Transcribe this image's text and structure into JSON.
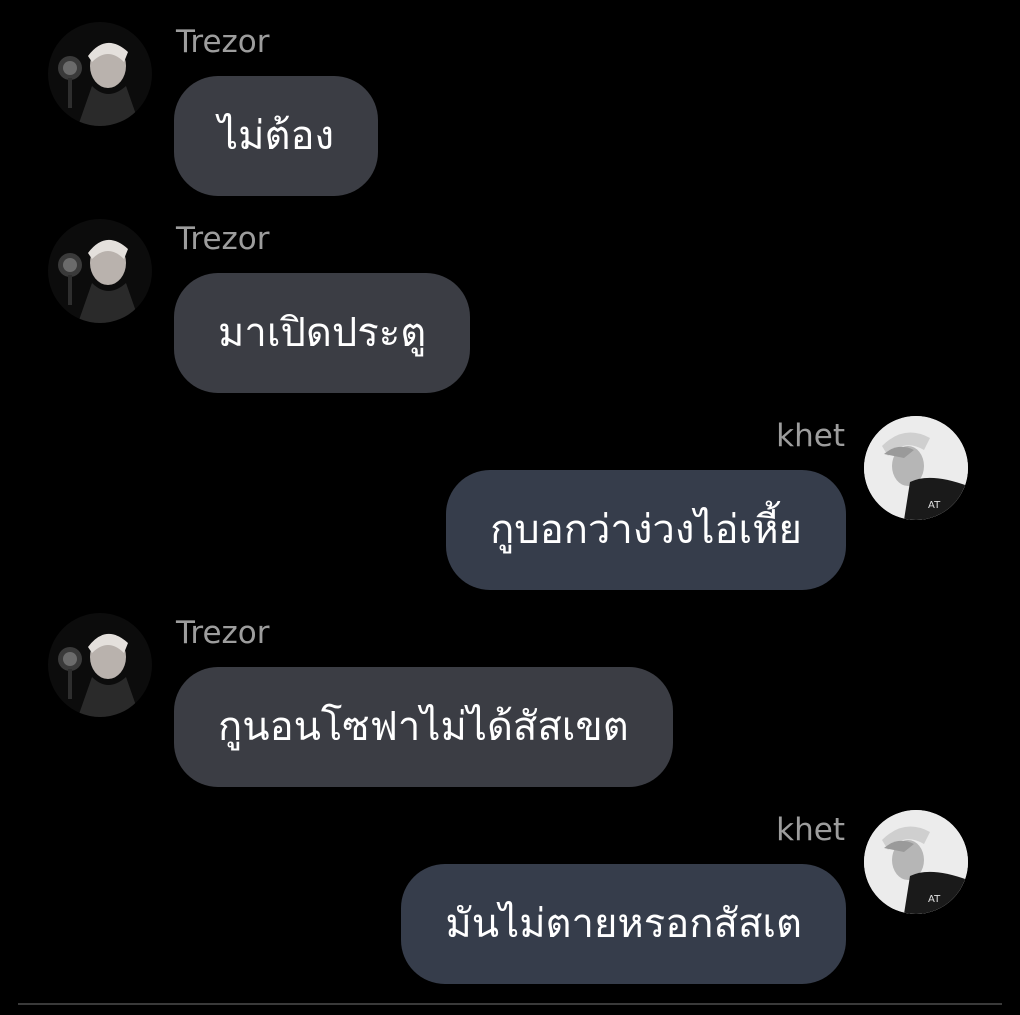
{
  "messages": [
    {
      "sender": "Trezor",
      "side": "left",
      "text": "ไม่ต้อง"
    },
    {
      "sender": "Trezor",
      "side": "left",
      "text": "มาเปิดประตู"
    },
    {
      "sender": "khet",
      "side": "right",
      "text": "กูบอกว่าง่วงไอ่เหี้ย"
    },
    {
      "sender": "Trezor",
      "side": "left",
      "text": "กูนอนโซฟาไม่ได้สัสเขต"
    },
    {
      "sender": "khet",
      "side": "right",
      "text": "มันไม่ตายหรอกสัสเต"
    }
  ],
  "colors": {
    "background": "#000000",
    "left_bubble": "#3b3d44",
    "right_bubble": "#363d4b",
    "sender_name": "#9d9d9d",
    "message_text": "#ffffff"
  }
}
